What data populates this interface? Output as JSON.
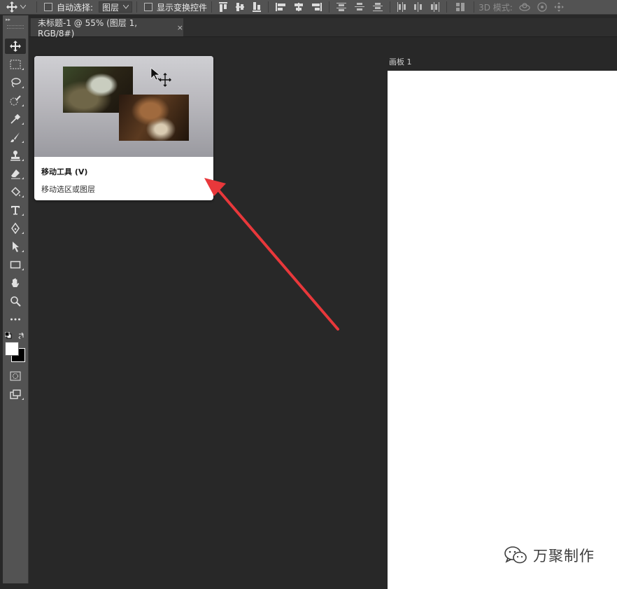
{
  "options_bar": {
    "auto_select_label": "自动选择:",
    "auto_select_value": "图层",
    "show_transform_label": "显示变换控件",
    "mode_3d_label": "3D 模式:"
  },
  "document": {
    "tab_title": "未标题-1 @ 55% (图层 1, RGB/8#)",
    "close_glyph": "×",
    "artboard_label": "画板 1"
  },
  "tooltip": {
    "title": "移动工具 (V)",
    "description": "移动选区或图层"
  },
  "watermark": {
    "text": "万聚制作"
  },
  "colors": {
    "arrow": "#e8383b",
    "foreground": "#ffffff",
    "background": "#000000"
  },
  "toolbox_icons": [
    "move-icon",
    "marquee-icon",
    "lasso-icon",
    "quick-select-icon",
    "eyedropper-icon",
    "brush-icon",
    "stamp-icon",
    "eraser-icon",
    "paint-bucket-icon",
    "type-icon",
    "pen-icon",
    "path-select-icon",
    "rectangle-icon",
    "hand-icon",
    "zoom-icon",
    "more-icon"
  ]
}
